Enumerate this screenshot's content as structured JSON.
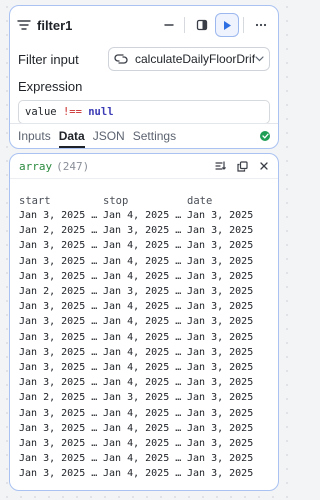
{
  "node": {
    "title": "filter1",
    "filter_input_label": "Filter input",
    "filter_input_value": "calculateDailyFloorDrift",
    "expression_label": "Expression",
    "expression": {
      "ident": "value",
      "op": "!==",
      "kw": "null"
    },
    "tabs": [
      "Inputs",
      "Data",
      "JSON",
      "Settings"
    ],
    "active_tab": "Data",
    "status_color": "#1f9d55"
  },
  "result": {
    "type": "array",
    "count": "(247)",
    "columns": [
      "start",
      "stop",
      "date"
    ],
    "rows": [
      [
        "Jan 3, 2025 …",
        "Jan 4, 2025 …",
        "Jan 3, 2025"
      ],
      [
        "Jan 2, 2025 …",
        "Jan 3, 2025 …",
        "Jan 3, 2025"
      ],
      [
        "Jan 3, 2025 …",
        "Jan 4, 2025 …",
        "Jan 3, 2025"
      ],
      [
        "Jan 3, 2025 …",
        "Jan 4, 2025 …",
        "Jan 3, 2025"
      ],
      [
        "Jan 3, 2025 …",
        "Jan 4, 2025 …",
        "Jan 3, 2025"
      ],
      [
        "Jan 2, 2025 …",
        "Jan 3, 2025 …",
        "Jan 3, 2025"
      ],
      [
        "Jan 3, 2025 …",
        "Jan 4, 2025 …",
        "Jan 3, 2025"
      ],
      [
        "Jan 3, 2025 …",
        "Jan 4, 2025 …",
        "Jan 3, 2025"
      ],
      [
        "Jan 3, 2025 …",
        "Jan 4, 2025 …",
        "Jan 3, 2025"
      ],
      [
        "Jan 3, 2025 …",
        "Jan 4, 2025 …",
        "Jan 3, 2025"
      ],
      [
        "Jan 3, 2025 …",
        "Jan 4, 2025 …",
        "Jan 3, 2025"
      ],
      [
        "Jan 3, 2025 …",
        "Jan 4, 2025 …",
        "Jan 3, 2025"
      ],
      [
        "Jan 2, 2025 …",
        "Jan 3, 2025 …",
        "Jan 3, 2025"
      ],
      [
        "Jan 3, 2025 …",
        "Jan 4, 2025 …",
        "Jan 3, 2025"
      ],
      [
        "Jan 3, 2025 …",
        "Jan 4, 2025 …",
        "Jan 3, 2025"
      ],
      [
        "Jan 3, 2025 …",
        "Jan 4, 2025 …",
        "Jan 3, 2025"
      ],
      [
        "Jan 3, 2025 …",
        "Jan 4, 2025 …",
        "Jan 3, 2025"
      ],
      [
        "Jan 3, 2025 …",
        "Jan 4, 2025 …",
        "Jan 3, 2025"
      ]
    ]
  },
  "icons": {
    "node_type": "filter-lines-icon",
    "collapse": "minus-icon",
    "layout": "sidebar-layout-icon",
    "run": "play-icon",
    "more": "more-horizontal-icon",
    "input_link": "link-loop-icon",
    "dropdown": "chevron-down-icon",
    "status": "check-circle-icon",
    "sort": "sort-lines-icon",
    "popout": "copy-window-icon",
    "close": "close-icon"
  },
  "colors": {
    "accent": "#2f6fe4",
    "border": "#a9c2f2",
    "string_type": "#2b8a3e",
    "operator": "#c92a2a",
    "keyword": "#3b3bb5"
  }
}
